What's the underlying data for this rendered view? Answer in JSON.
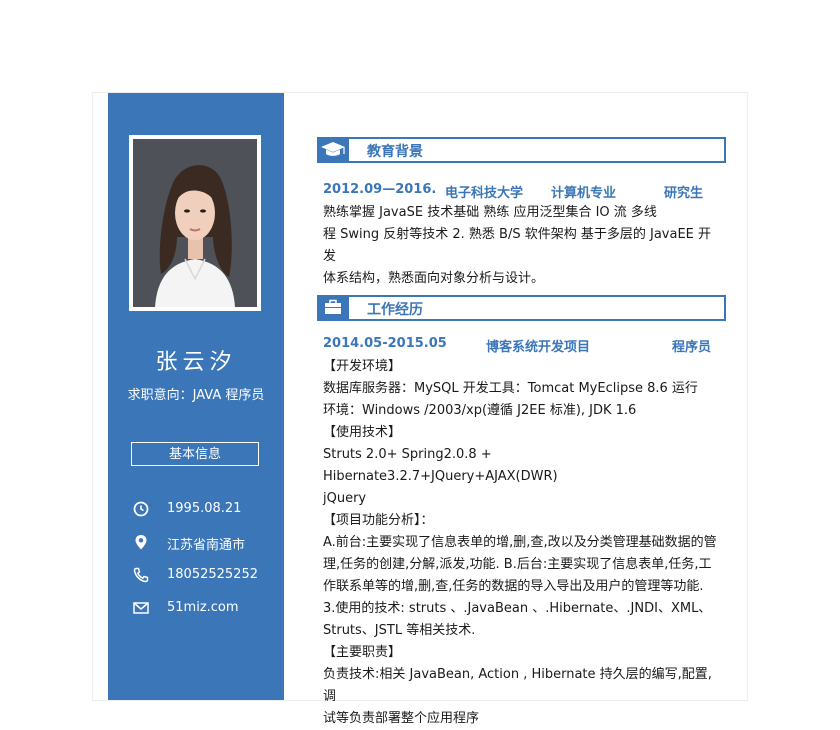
{
  "profile": {
    "name": "张云汐",
    "intent": "求职意向：JAVA 程序员",
    "basic_info_label": "基本信息",
    "contacts": [
      {
        "icon": "clock-icon",
        "value": "1995.08.21"
      },
      {
        "icon": "location-pin-icon",
        "value": "江苏省南通市"
      },
      {
        "icon": "phone-icon",
        "value": "18052525252"
      },
      {
        "icon": "envelope-icon",
        "value": "51miz.com"
      }
    ]
  },
  "education": {
    "title": "教育背景",
    "period": "2012.09—2016.",
    "school": "电子科技大学",
    "major": "计算机专业",
    "degree": "研究生",
    "lines": [
      "熟练掌握 JavaSE 技术基础 熟练 应用泛型集合 IO 流 多线",
      "程 Swing 反射等技术 2. 熟悉 B/S 软件架构 基于多层的 JavaEE 开发",
      "体系结构，熟悉面向对象分析与设计。"
    ]
  },
  "work": {
    "title": "工作经历",
    "period": "2014.05-2015.05",
    "project": "博客系统开发项目",
    "role": "程序员",
    "lines": [
      "【开发环境】",
      "数据库服务器：MySQL   开发工具：Tomcat MyEclipse 8.6   运行",
      "环境：Windows /2003/xp(遵循 J2EE 标准), JDK 1.6",
      "【使用技术】",
      "Struts 2.0+ Spring2.0.8 + Hibernate3.2.7+JQuery+AJAX(DWR)",
      "jQuery",
      "【项目功能分析】：",
      "A.前台:主要实现了信息表单的增,删,查,改以及分类管理基础数据的管",
      "理,任务的创建,分解,派发,功能.    B.后台:主要实现了信息表单,任务,工",
      "作联系单等的增,删,查,任务的数据的导入导出及用户的管理等功能.",
      "3.使用的技术:    struts  、.JavaBean  、.Hibernate、.JNDI、XML、",
      "Struts、JSTL 等相关技术.",
      "【主要职责】",
      "负责技术:相关 JavaBean, Action , Hibernate 持久层的编写,配置,调",
      "试等负责部署整个应用程序"
    ]
  },
  "colors": {
    "accent": "#3b76b8",
    "text": "#1a1a1a",
    "background": "#ffffff"
  }
}
